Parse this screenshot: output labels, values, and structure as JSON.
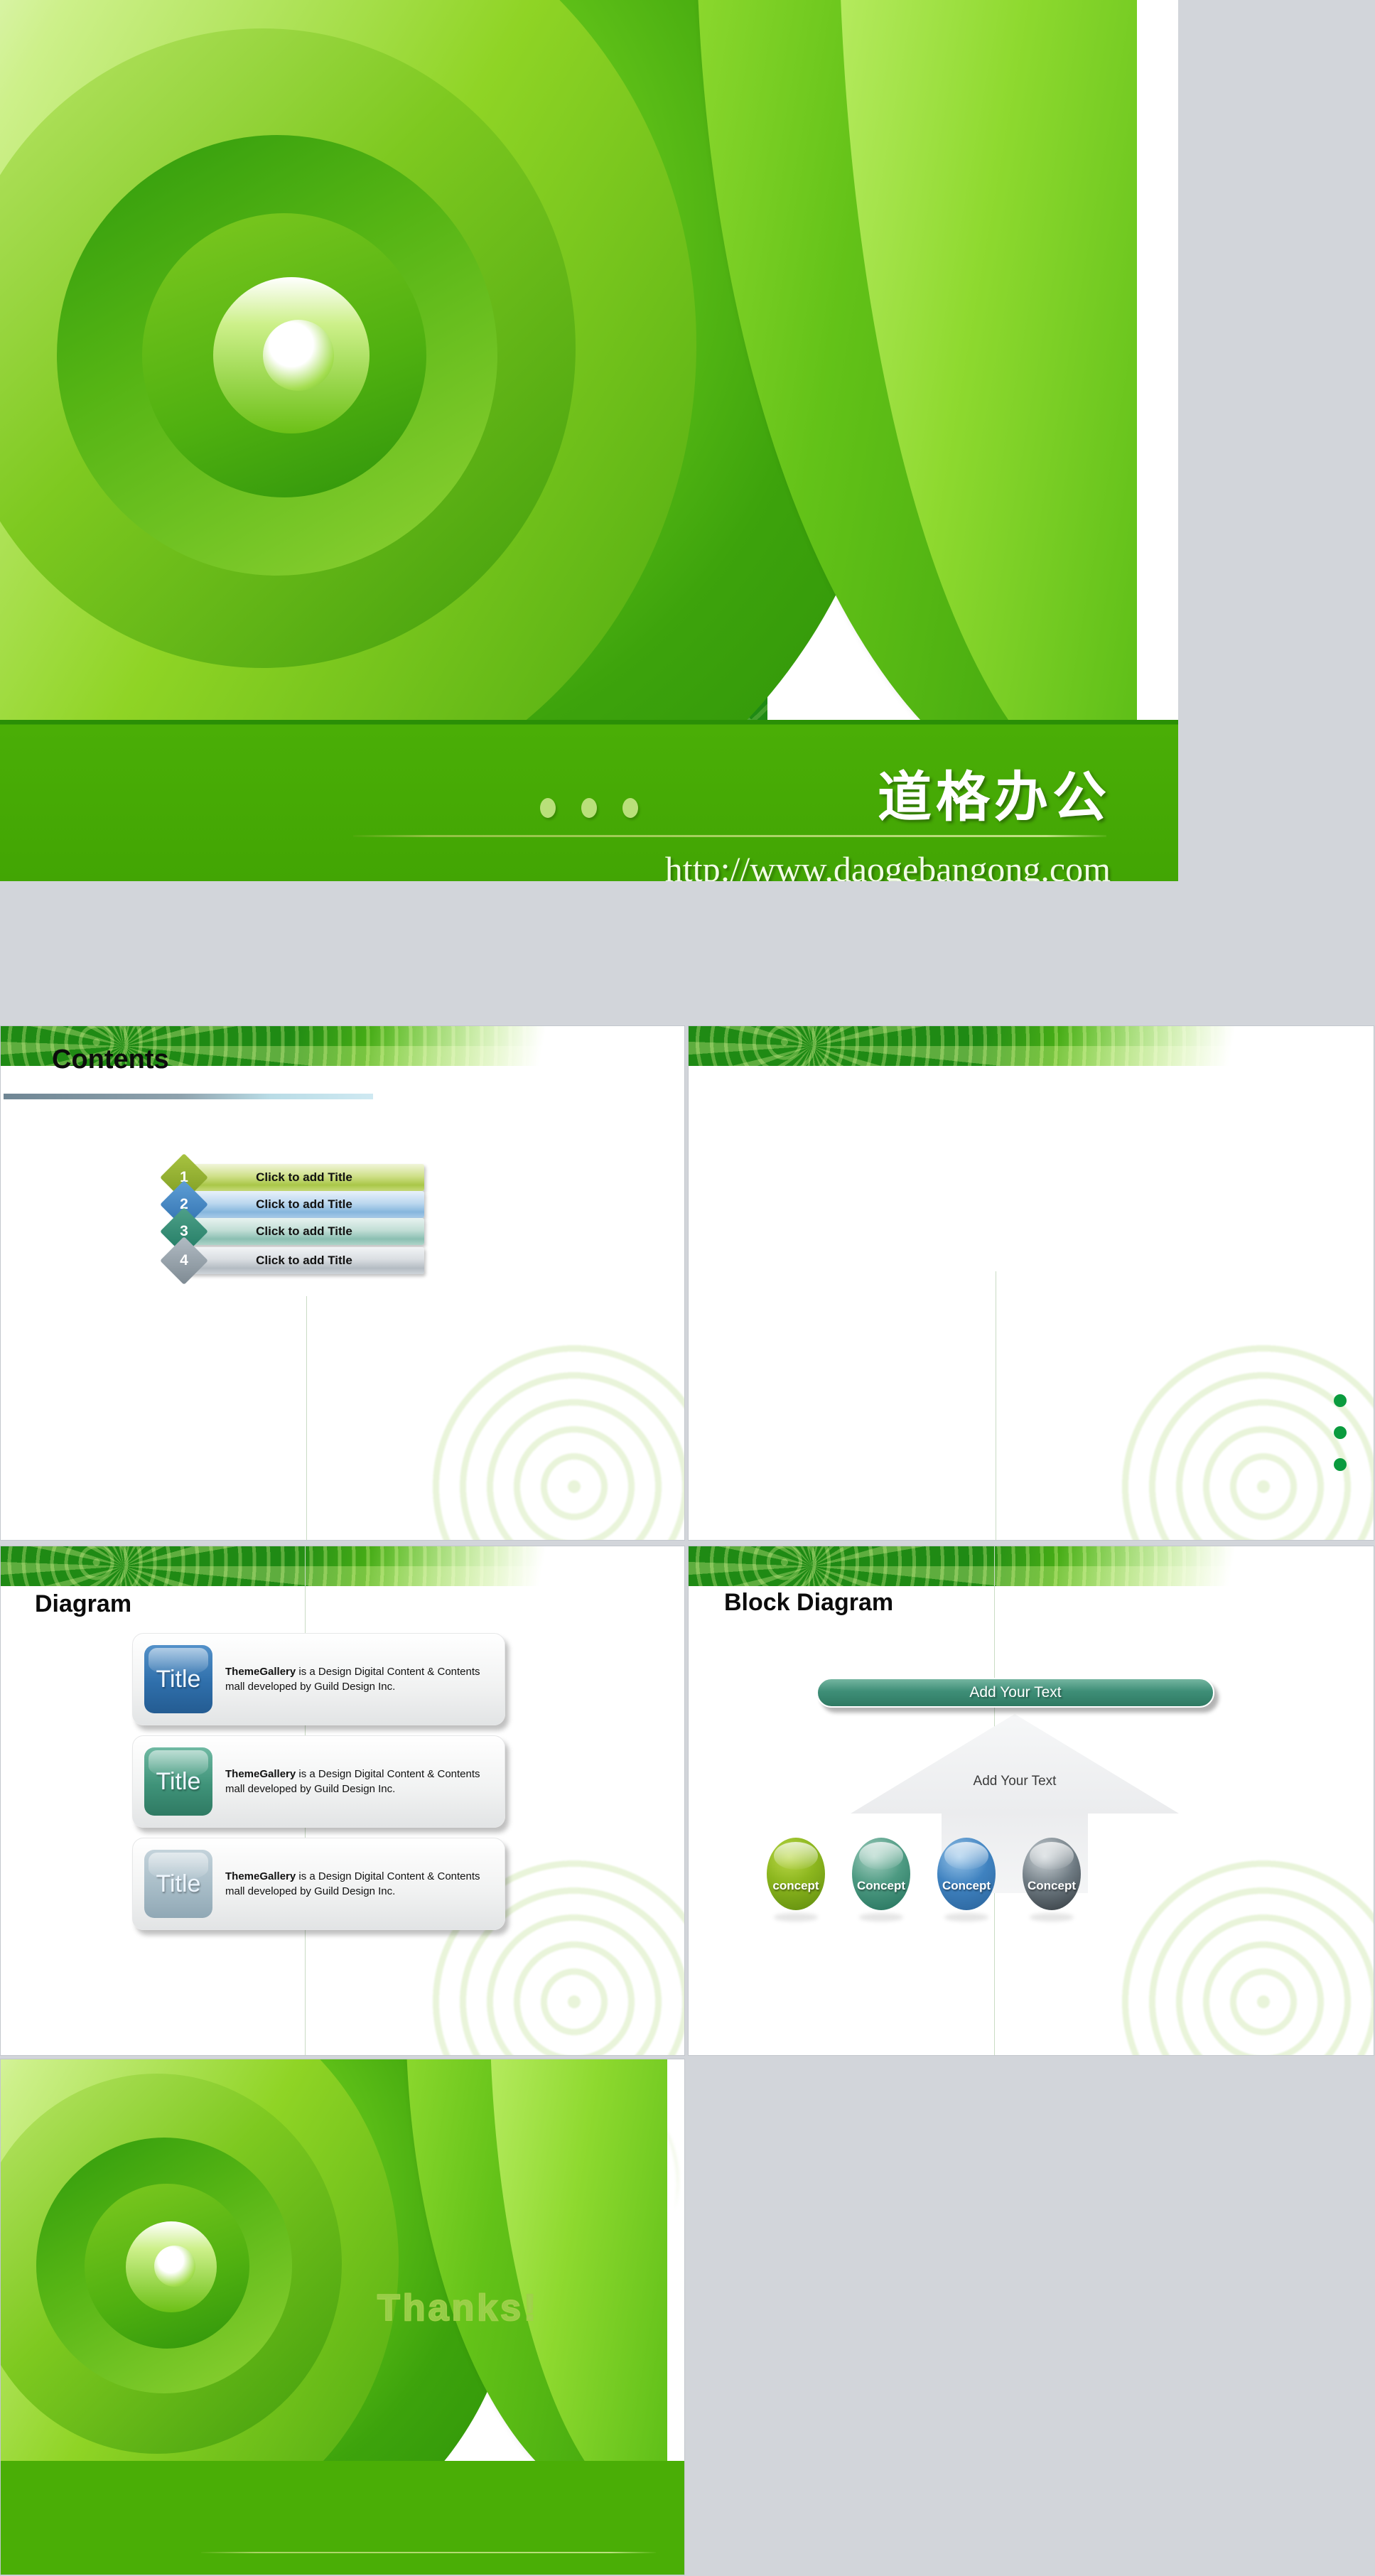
{
  "deck": {
    "title_slide": {
      "heading_cn": "道格办公",
      "url": "http://www.daogebangong.com",
      "dots": [
        "dot-1",
        "dot-2",
        "dot-3"
      ],
      "band_color": "#42a504"
    },
    "contents_slide": {
      "title": "Contents",
      "items": [
        {
          "number": "1",
          "label": "Click to add Title",
          "color": "#a9c748"
        },
        {
          "number": "2",
          "label": "Click to add Title",
          "color": "#86b6dd"
        },
        {
          "number": "3",
          "label": "Click to add Title",
          "color": "#8bbfb2"
        },
        {
          "number": "4",
          "label": "Click to add Title",
          "color": "#b4bcc3"
        }
      ]
    },
    "blank_slide": {
      "dot_color": "#0a9b3e",
      "dots": [
        "dot-1",
        "dot-2",
        "dot-3"
      ]
    },
    "diagram_slide": {
      "title": "Diagram",
      "cards": [
        {
          "badge": "Title",
          "lead": "ThemeGallery",
          "body": " is a Design Digital Content & Contents mall developed by Guild Design Inc.",
          "color": "#2f6fab"
        },
        {
          "badge": "Title",
          "lead": "ThemeGallery",
          "body": " is a Design Digital Content & Contents mall developed by Guild Design Inc.",
          "color": "#3f9379"
        },
        {
          "badge": "Title",
          "lead": "ThemeGallery",
          "body": " is a Design Digital Content & Contents mall developed by Guild Design Inc.",
          "color": "#a7bcc7"
        }
      ]
    },
    "block_slide": {
      "title": "Block Diagram",
      "pill_label": "Add Your Text",
      "arrow_label": "Add Your Text",
      "circles": [
        {
          "label": "concept",
          "color": "#8cb61e"
        },
        {
          "label": "Concept",
          "color": "#4d9a82"
        },
        {
          "label": "Concept",
          "color": "#3f82c0"
        },
        {
          "label": "Concept",
          "color": "#6e7a82"
        }
      ]
    },
    "thanks_slide": {
      "text": "Thanks!",
      "band_color": "#4aae06"
    }
  }
}
